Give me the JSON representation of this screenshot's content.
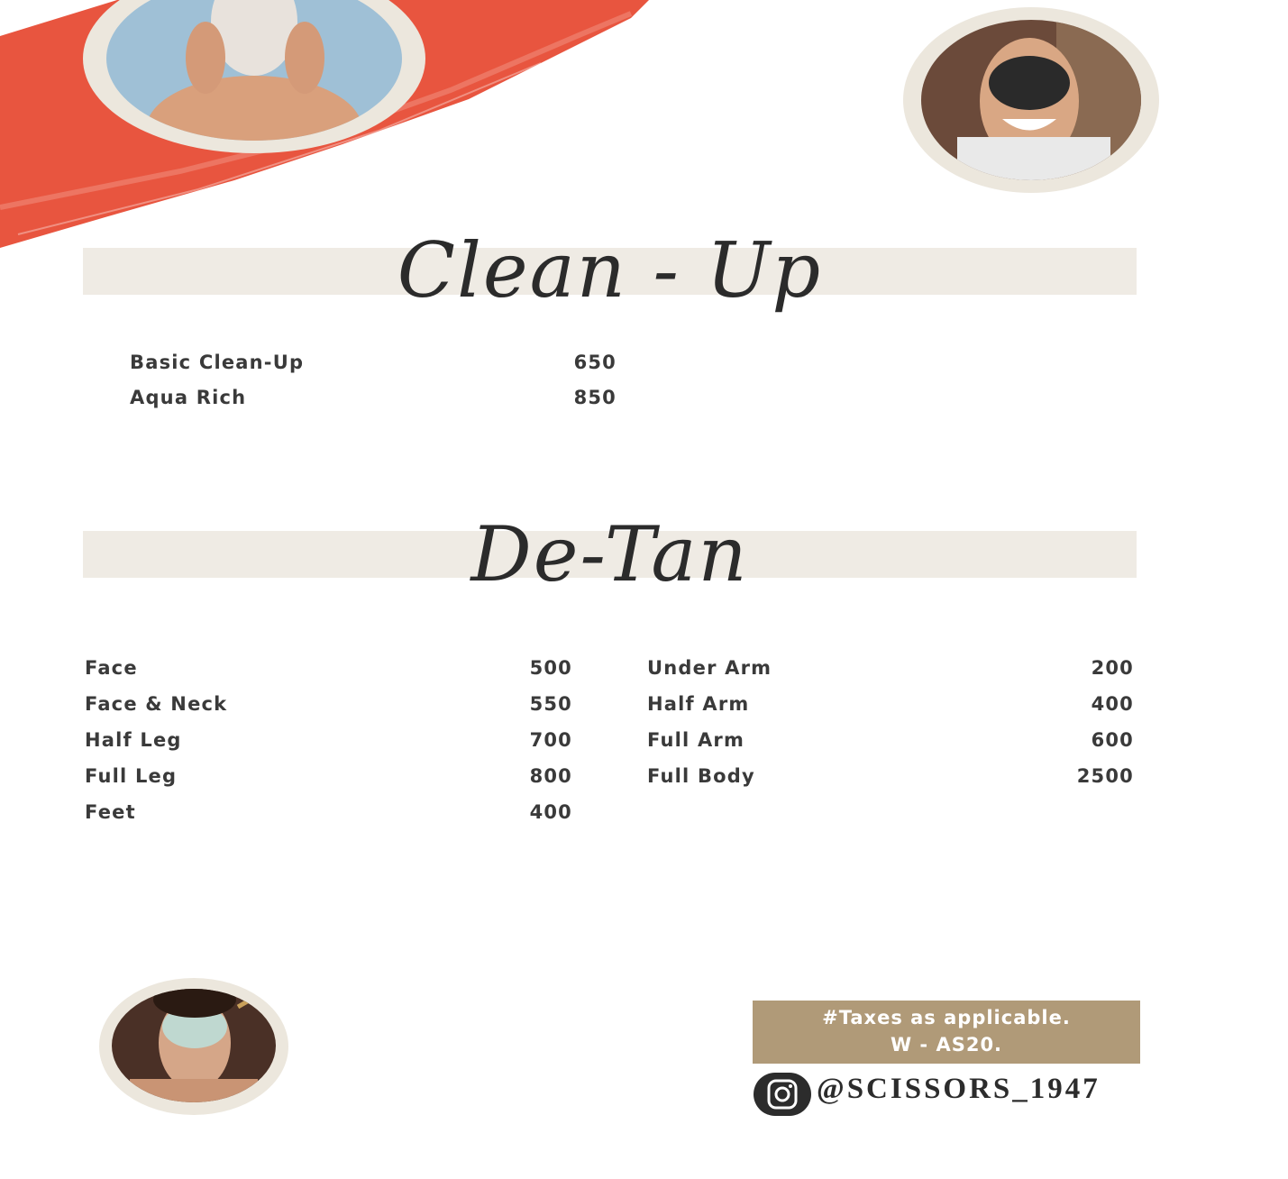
{
  "sections": {
    "cleanup": {
      "title": "Clean - Up",
      "items": [
        {
          "name": "Basic Clean-Up",
          "price": "650"
        },
        {
          "name": "Aqua Rich",
          "price": "850"
        }
      ]
    },
    "detan": {
      "title": "De-Tan",
      "left_items": [
        {
          "name": "Face",
          "price": "500"
        },
        {
          "name": "Face & Neck",
          "price": "550"
        },
        {
          "name": "Half Leg",
          "price": "700"
        },
        {
          "name": "Full Leg",
          "price": "800"
        },
        {
          "name": "Feet",
          "price": "400"
        }
      ],
      "right_items": [
        {
          "name": "Under Arm",
          "price": "200"
        },
        {
          "name": "Half Arm",
          "price": "400"
        },
        {
          "name": "Full Arm",
          "price": "600"
        },
        {
          "name": "Full Body",
          "price": "2500"
        }
      ]
    }
  },
  "footer": {
    "tax_line1": "#Taxes as applicable.",
    "tax_line2": "W - AS20.",
    "handle": "@SCISSORS_1947",
    "icon": "instagram-icon"
  },
  "colors": {
    "brush": "#e8553f",
    "band": "#efebe4",
    "tax_box": "#b09a78",
    "text": "#3a3a3a"
  }
}
